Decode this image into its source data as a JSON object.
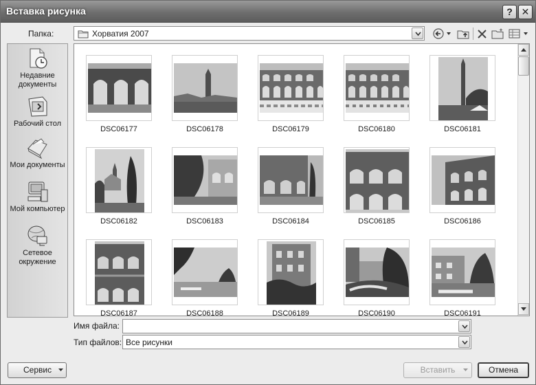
{
  "dialog": {
    "title": "Вставка рисунка",
    "help_label": "?",
    "close_label": "✕"
  },
  "folder": {
    "label": "Папка:",
    "value": "Хорватия 2007"
  },
  "places": [
    {
      "label": "Недавние документы",
      "icon": "recent-documents-icon"
    },
    {
      "label": "Рабочий стол",
      "icon": "desktop-icon"
    },
    {
      "label": "Мои документы",
      "icon": "my-documents-icon"
    },
    {
      "label": "Мой компьютер",
      "icon": "my-computer-icon"
    },
    {
      "label": "Сетевое окружение",
      "icon": "network-places-icon"
    }
  ],
  "files": [
    {
      "name": "DSC06177"
    },
    {
      "name": "DSC06178"
    },
    {
      "name": "DSC06179"
    },
    {
      "name": "DSC06180"
    },
    {
      "name": "DSC06181"
    },
    {
      "name": "DSC06182"
    },
    {
      "name": "DSC06183"
    },
    {
      "name": "DSC06184"
    },
    {
      "name": "DSC06185"
    },
    {
      "name": "DSC06186"
    },
    {
      "name": "DSC06187"
    },
    {
      "name": "DSC06188"
    },
    {
      "name": "DSC06189"
    },
    {
      "name": "DSC06190"
    },
    {
      "name": "DSC06191"
    }
  ],
  "filename": {
    "label": "Имя файла:",
    "value": ""
  },
  "filetype": {
    "label": "Тип файлов:",
    "value": "Все рисунки"
  },
  "buttons": {
    "service": "Сервис",
    "insert": "Вставить",
    "cancel": "Отмена"
  }
}
